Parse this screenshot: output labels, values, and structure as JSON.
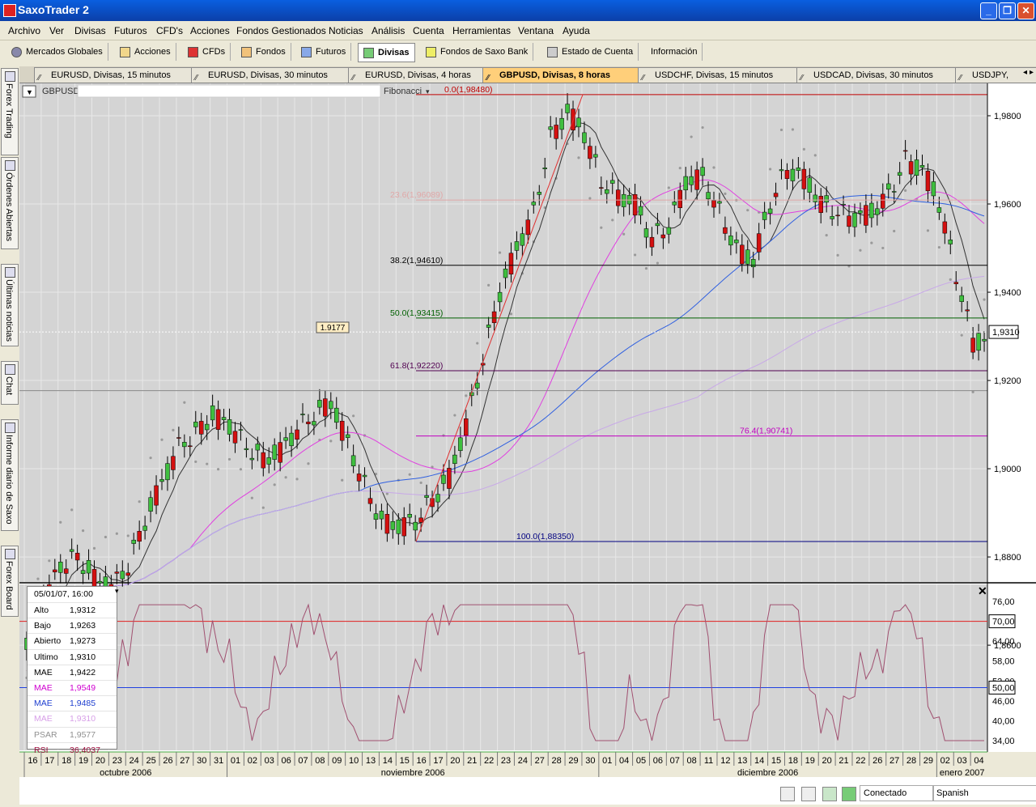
{
  "window": {
    "title": "SaxoTrader 2",
    "controls": {
      "minimize": "_",
      "restore": "❐",
      "close": "✕"
    }
  },
  "menu": [
    "Archivo",
    "Ver",
    "Divisas",
    "Futuros",
    "CFD's",
    "Acciones",
    "Fondos Gestionados",
    "Noticias",
    "Análisis",
    "Cuenta",
    "Herramientas",
    "Ventana",
    "Ayuda"
  ],
  "toolbar": [
    "Mercados Globales",
    "Acciones",
    "CFDs",
    "Fondos",
    "Futuros",
    "Divisas",
    "Fondos de Saxo Bank",
    "Estado de Cuenta",
    "Información"
  ],
  "toolbar_active": "Divisas",
  "tabs": [
    "EURUSD, Divisas, 15 minutos",
    "EURUSD, Divisas, 30 minutos",
    "EURUSD, Divisas, 4 horas",
    "GBPUSD, Divisas, 8 horas",
    "USDCHF, Divisas, 15 minutos",
    "USDCAD, Divisas, 30 minutos",
    "USDJPY,"
  ],
  "active_tab": "GBPUSD, Divisas, 8 horas",
  "sidebar": [
    "Forex Trading",
    "Órdenes Abiertas",
    "Últimas noticias",
    "Chat",
    "Informe diario de Saxo",
    "Forex Board"
  ],
  "chart_header": {
    "symbol": "GBPUSD",
    "tool": "Fibonacci"
  },
  "price_axis": [
    "1,9800",
    "1,9600",
    "1,9400",
    "1,9200",
    "1,9000",
    "1,8800",
    "1,8600"
  ],
  "current_price": "1,9310",
  "fibonacci": [
    {
      "label": "0.0(1,98480)",
      "value": 1.9848,
      "color": "#c00000"
    },
    {
      "label": "23.6(1,96089)",
      "value": 1.96089,
      "color": "#e0a8a8"
    },
    {
      "label": "38.2(1,94610)",
      "value": 1.9461,
      "color": "#000000"
    },
    {
      "label": "50.0(1,93415)",
      "value": 1.93415,
      "color": "#006000"
    },
    {
      "label": "61.8(1,92220)",
      "value": 1.9222,
      "color": "#500050"
    },
    {
      "label": "76.4(1,90741)",
      "value": 1.90741,
      "color": "#c000c0"
    },
    {
      "label": "100.0(1,88350)",
      "value": 1.8835,
      "color": "#000080"
    }
  ],
  "marker_label": "1.9177",
  "info_box": {
    "date": "05/01/07, 16:00",
    "rows": [
      {
        "label": "Alto",
        "value": "1,9312",
        "color": "#000000"
      },
      {
        "label": "Bajo",
        "value": "1,9263",
        "color": "#000000"
      },
      {
        "label": "Abierto",
        "value": "1,9273",
        "color": "#000000"
      },
      {
        "label": "Ultimo",
        "value": "1,9310",
        "color": "#000000"
      },
      {
        "label": "MAE",
        "value": "1,9422",
        "color": "#000000"
      },
      {
        "label": "MAE",
        "value": "1,9549",
        "color": "#d000d0"
      },
      {
        "label": "MAE",
        "value": "1,9485",
        "color": "#2040d0"
      },
      {
        "label": "MAE",
        "value": "1,9310",
        "color": "#d8a0e8"
      },
      {
        "label": "PSAR",
        "value": "1,9577",
        "color": "#909090"
      },
      {
        "label": "RSI",
        "value": "36,4037",
        "color": "#a01040"
      }
    ]
  },
  "rsi_axis": [
    "76,00",
    "70,00",
    "64,00",
    "58,00",
    "52,00",
    "50,00",
    "46,00",
    "40,00",
    "34,00"
  ],
  "rsi_levels": {
    "upper": "70,00",
    "lower": "50,00"
  },
  "date_axis": [
    "16",
    "17",
    "18",
    "19",
    "20",
    "23",
    "24",
    "25",
    "26",
    "27",
    "30",
    "31",
    "01",
    "02",
    "03",
    "06",
    "07",
    "08",
    "09",
    "10",
    "13",
    "14",
    "15",
    "16",
    "17",
    "20",
    "21",
    "22",
    "23",
    "24",
    "27",
    "28",
    "29",
    "30",
    "01",
    "04",
    "05",
    "06",
    "07",
    "08",
    "11",
    "12",
    "13",
    "14",
    "15",
    "18",
    "19",
    "20",
    "21",
    "22",
    "26",
    "27",
    "28",
    "29",
    "02",
    "03",
    "04"
  ],
  "months": [
    "octubre 2006",
    "noviembre 2006",
    "diciembre 2006",
    "enero 2007"
  ],
  "status": {
    "connection": "Conectado",
    "language": "Spanish"
  }
}
